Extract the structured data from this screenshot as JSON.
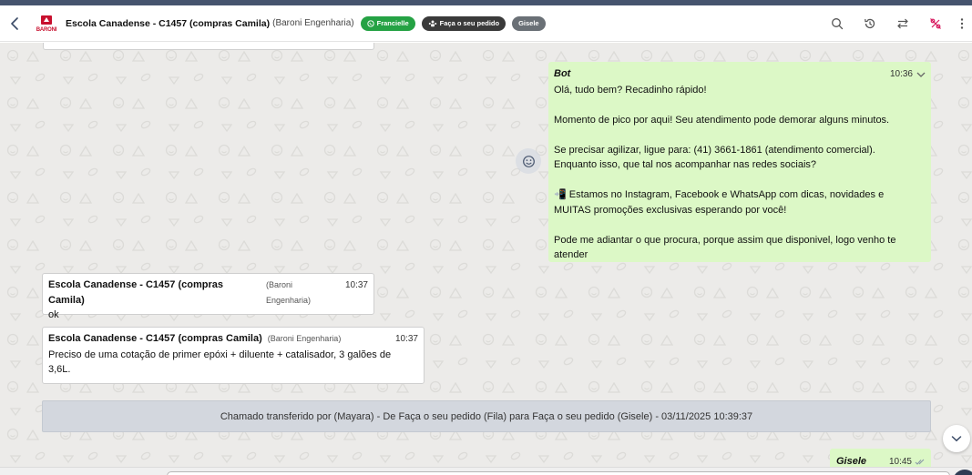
{
  "header": {
    "back_icon": "chevron-left-icon",
    "logo_text": "BARONI",
    "contact_name": "Escola Canadense - C1457 (compras Camila)",
    "contact_company": "(Baroni Engenharia)",
    "tags": [
      {
        "label": "Francielle",
        "icon": "whatsapp-icon",
        "color": "#25a244"
      },
      {
        "label": "Faça o seu pedido",
        "icon": "queue-icon",
        "color": "#3a3a3a"
      },
      {
        "label": "Gisele",
        "icon": "",
        "color": "#6a7076"
      }
    ],
    "actions": [
      "search-icon",
      "history-icon",
      "transfer-icon",
      "percent-off-icon",
      "more-vertical-icon"
    ]
  },
  "messages": [
    {
      "type": "outgoing",
      "sender": "Bot",
      "time": "10:36",
      "text": "Olá, tudo bem? Recadinho rápido!\n\nMomento de pico por aqui! Seu atendimento pode demorar alguns minutos.\n\nSe precisar agilizar, ligue para: (41) 3661-1861 (atendimento comercial).\nEnquanto isso, que tal nos acompanhar nas redes sociais?\n\n📲 Estamos no Instagram, Facebook e WhatsApp com dicas, novidades e\nMUITAS promoções exclusivas esperando por você!\n\nPode me adiantar o que procura, porque assim que disponivel, logo venho te\natender"
    },
    {
      "type": "incoming",
      "sender": "Escola Canadense - C1457 (compras Camila)",
      "company": "(Baroni Engenharia)",
      "time": "10:37",
      "text": "ok"
    },
    {
      "type": "incoming",
      "sender": "Escola Canadense - C1457 (compras Camila)",
      "company": "(Baroni Engenharia)",
      "time": "10:37",
      "text": "Preciso de uma cotação de primer epóxi + diluente + catalisador, 3 galões de\n3,6L."
    },
    {
      "type": "outgoing",
      "sender": "Gisele",
      "time": "10:45",
      "text": ""
    }
  ],
  "system_banner": "Chamado transferido por (Mayara) - De Faça o seu pedido (Fila) para Faça o seu pedido (Gisele) - 03/11/2025 10:39:37",
  "colors": {
    "outgoing_bubble": "#dcf8c6",
    "incoming_bubble": "#ffffff",
    "chat_background": "#ecebe9",
    "banner": "#d3d7de",
    "accent_green": "#25a244"
  }
}
